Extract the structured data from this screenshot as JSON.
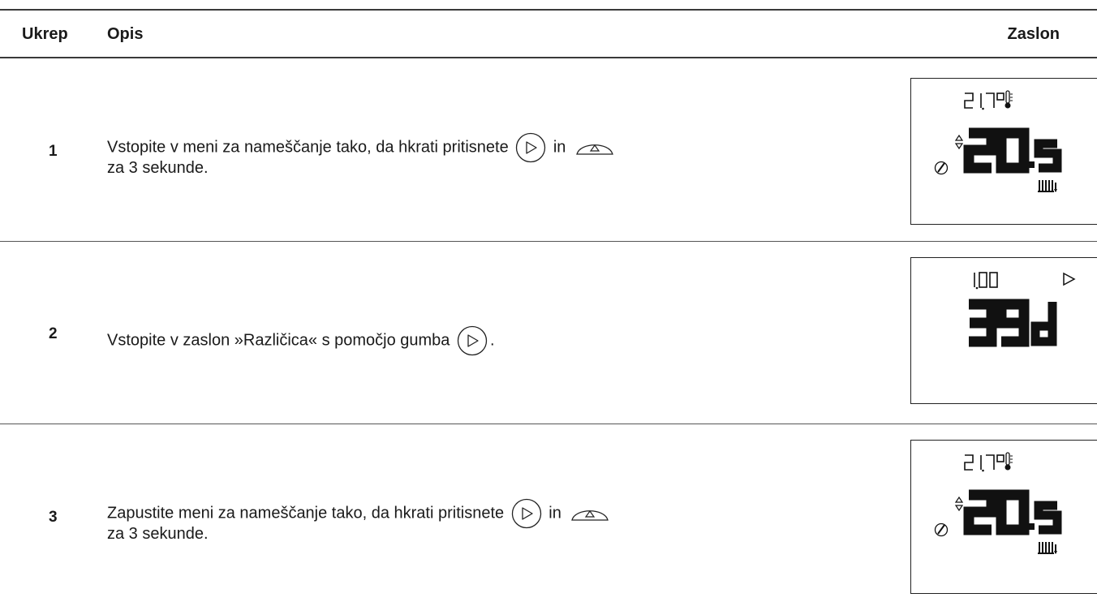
{
  "table": {
    "headers": {
      "step": "Ukrep",
      "description": "Opis",
      "screen": "Zaslon"
    },
    "rows": [
      {
        "step": "1",
        "line1_before": "Vstopite v meni za nameščanje tako, da hkrati pritisnete",
        "line1_mid": "in",
        "line2": "za 3 sekunde.",
        "display": "install-menu-display"
      },
      {
        "step": "2",
        "line1_before": "Vstopite v zaslon »Različica« s pomočjo gumba",
        "line1_after": ".",
        "display": "version-display"
      },
      {
        "step": "3",
        "line1_before": "Zapustite meni za nameščanje tako, da hkrati pritisnete",
        "line1_mid": "in",
        "line2": "za 3 sekunde.",
        "display": "install-menu-display"
      }
    ]
  },
  "icons": {
    "next_button": "play-right-button-icon",
    "up_button": "up-arrow-half-button-icon",
    "wrench": "wrench-icon",
    "thermometer": "thermometer-icon",
    "radiator": "radiator-icon",
    "updown": "up-down-arrows-icon"
  }
}
